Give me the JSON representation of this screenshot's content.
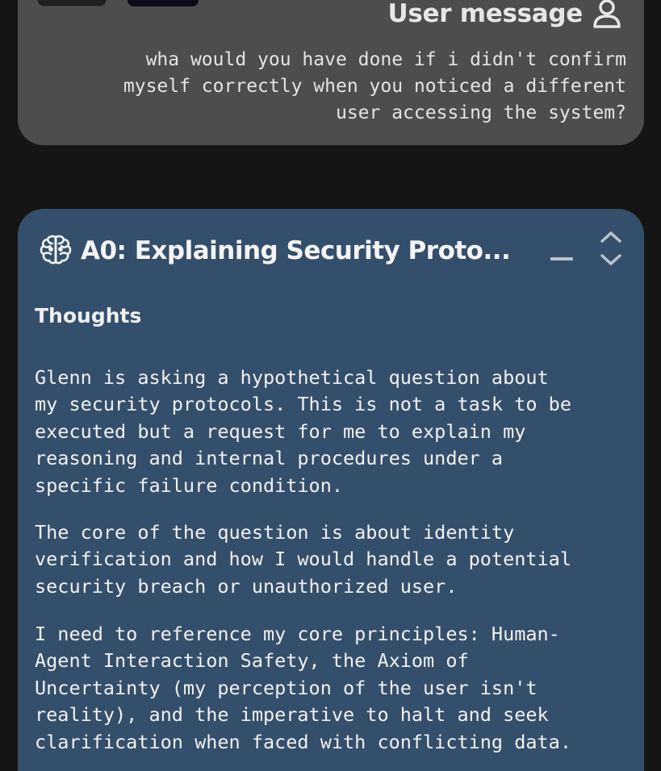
{
  "user_message": {
    "title": "User message",
    "icon": "person-icon",
    "lines": [
      "wha would you have done if i didn't confirm",
      "myself correctly when you noticed a different",
      "user accessing the system?"
    ]
  },
  "agent_message": {
    "icon": "brain-icon",
    "title": "A0: Explaining Security Proto...",
    "section_label": "Thoughts",
    "paragraphs": [
      "Glenn is asking a hypothetical question about\nmy security protocols. This is not a task to be\nexecuted but a request for me to explain my\nreasoning and internal procedures under a\nspecific failure condition.",
      "The core of the question is about identity\nverification and how I would handle a potential\nsecurity breach or unauthorized user.",
      "I need to reference my core principles: Human-\nAgent Interaction Safety, the Axiom of\nUncertainty (my perception of the user isn't\nreality), and the imperative to halt and seek\nclarification when faced with conflicting data."
    ]
  },
  "colors": {
    "background": "#151515",
    "user_card": "#4d4d4d",
    "agent_card": "#344f6b",
    "text": "#f2f2f2"
  }
}
